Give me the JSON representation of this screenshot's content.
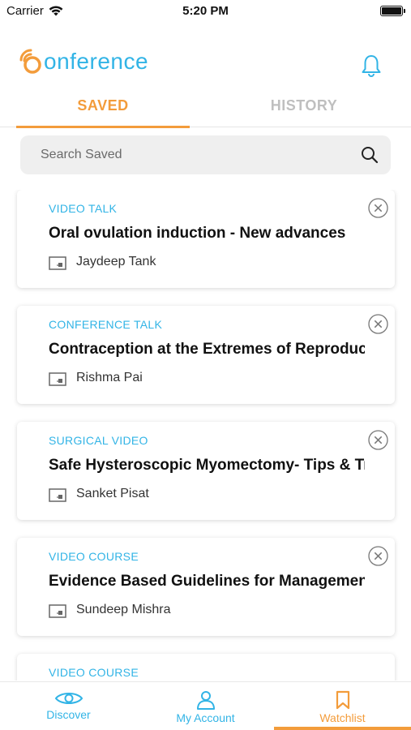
{
  "status_bar": {
    "carrier": "Carrier",
    "time": "5:20 PM"
  },
  "header": {
    "logo_text": "onference",
    "logo_color": "#32b4e6",
    "accent_color": "#f39c3b"
  },
  "tabs": [
    {
      "label": "SAVED",
      "active": true
    },
    {
      "label": "HISTORY",
      "active": false
    }
  ],
  "search": {
    "placeholder": "Search Saved",
    "value": ""
  },
  "cards": [
    {
      "type": "VIDEO TALK",
      "title": "Oral ovulation induction - New advances",
      "author": "Jaydeep Tank"
    },
    {
      "type": "CONFERENCE TALK",
      "title": "Contraception at the Extremes of Reproductive Age",
      "author": "Rishma Pai"
    },
    {
      "type": "SURGICAL VIDEO",
      "title": "Safe Hysteroscopic Myomectomy- Tips & Tricks",
      "author": "Sanket Pisat"
    },
    {
      "type": "VIDEO COURSE",
      "title": "Evidence Based Guidelines for Management",
      "author": "Sundeep Mishra"
    },
    {
      "type": "VIDEO COURSE",
      "title": "",
      "author": ""
    }
  ],
  "bottom_nav": [
    {
      "label": "Discover",
      "icon": "eye-icon"
    },
    {
      "label": "My Account",
      "icon": "user-icon"
    },
    {
      "label": "Watchlist",
      "icon": "bookmark-icon",
      "active": true
    }
  ]
}
